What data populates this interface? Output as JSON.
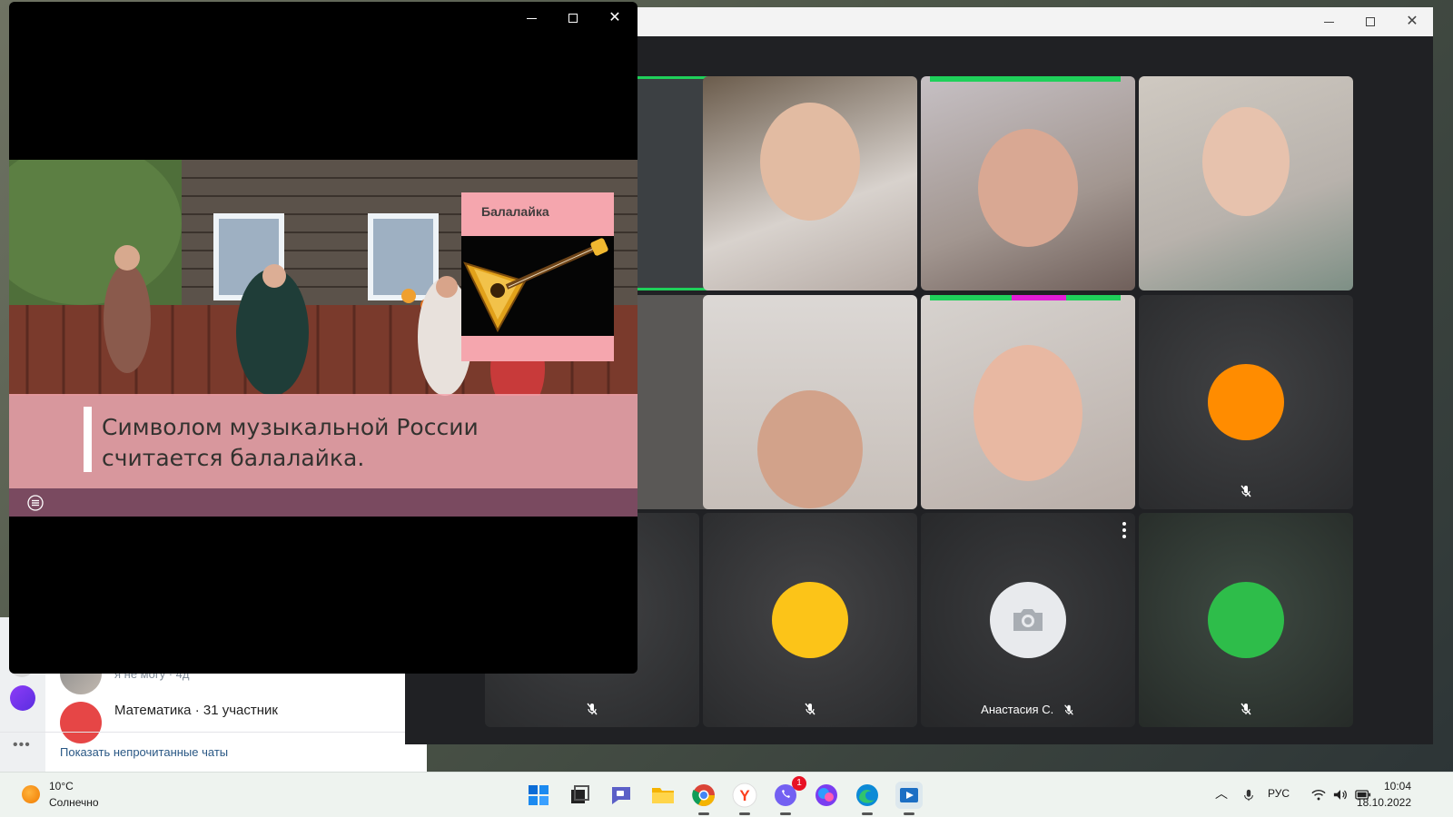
{
  "messenger": {
    "chats": [
      {
        "preview": "я не могу · 4д"
      },
      {
        "title": "Математика · 31 участник"
      }
    ],
    "show_unread_link": "Показать непрочитанные чаты"
  },
  "meeting": {
    "tiles": [
      {
        "type": "avatar",
        "color": "#ff8c00",
        "muted": true
      },
      {
        "type": "avatar",
        "color": "#fcc418",
        "muted": true
      },
      {
        "type": "camera-off",
        "name": "Анастасия С.",
        "muted": true
      },
      {
        "type": "avatar",
        "color": "#2ebd4a",
        "muted": true
      }
    ]
  },
  "slide": {
    "card_title": "Балалайка",
    "caption_line1": "Символом музыкальной России",
    "caption_line2": "считается балалайка."
  },
  "taskbar": {
    "weather_temp": "10°C",
    "weather_condition": "Солнечно",
    "language": "РУС",
    "time": "10:04",
    "date": "18.10.2022",
    "notification_count": "1"
  },
  "colors": {
    "speaking_border": "#1fd05a",
    "slide_pink": "#f5a6ae",
    "slide_footer": "#7a4a60"
  }
}
